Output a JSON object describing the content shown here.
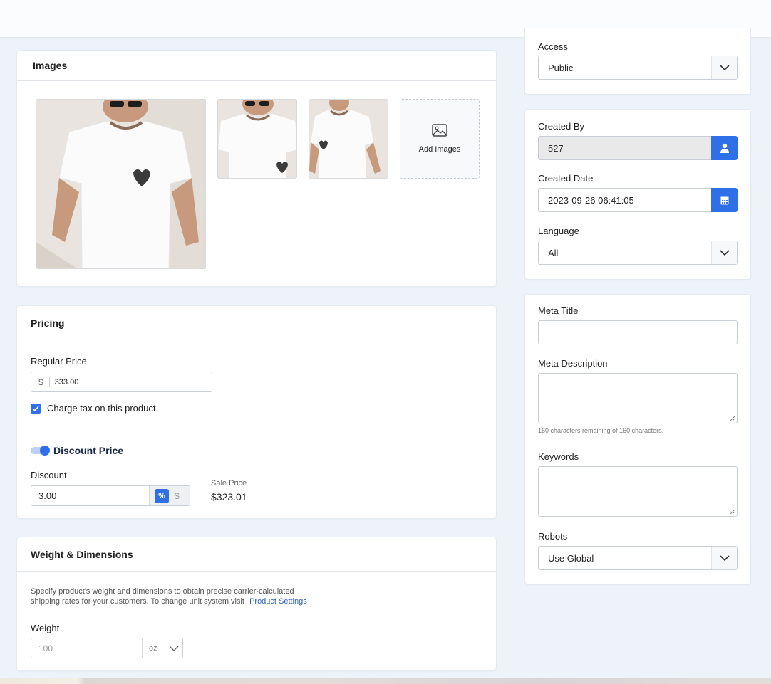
{
  "images": {
    "title": "Images",
    "add_label": "Add Images"
  },
  "pricing": {
    "title": "Pricing",
    "regular_price_label": "Regular Price",
    "currency_symbol": "$",
    "regular_price_value": "333.00",
    "charge_tax_label": "Charge tax on this product",
    "charge_tax_checked": true,
    "discount_price_label": "Discount Price",
    "discount_price_enabled": true,
    "discount_label": "Discount",
    "discount_value": "3.00",
    "discount_unit_percent": "%",
    "discount_unit_dollar": "$",
    "sale_price_label": "Sale Price",
    "sale_price_value": "$323.01"
  },
  "weight": {
    "title": "Weight & Dimensions",
    "description_line1": "Specify product's weight and dimensions to obtain precise carrier-calculated",
    "description_line2": "shipping rates for your customers. To change unit system visit",
    "settings_link": "Product Settings",
    "weight_label": "Weight",
    "weight_placeholder": "100",
    "weight_unit": "oz"
  },
  "sidebar": {
    "access_label": "Access",
    "access_value": "Public",
    "created_by_label": "Created By",
    "created_by_value": "527",
    "created_date_label": "Created Date",
    "created_date_value": "2023-09-26 06:41:05",
    "language_label": "Language",
    "language_value": "All",
    "meta_title_label": "Meta Title",
    "meta_title_value": "",
    "meta_description_label": "Meta Description",
    "meta_description_value": "",
    "meta_description_hint": "160 characters remaining of 160 characters.",
    "keywords_label": "Keywords",
    "keywords_value": "",
    "robots_label": "Robots",
    "robots_value": "Use Global"
  },
  "colors": {
    "accent": "#2f6fe8",
    "link": "#2b5fb5",
    "page_bg": "#eef3fa"
  }
}
